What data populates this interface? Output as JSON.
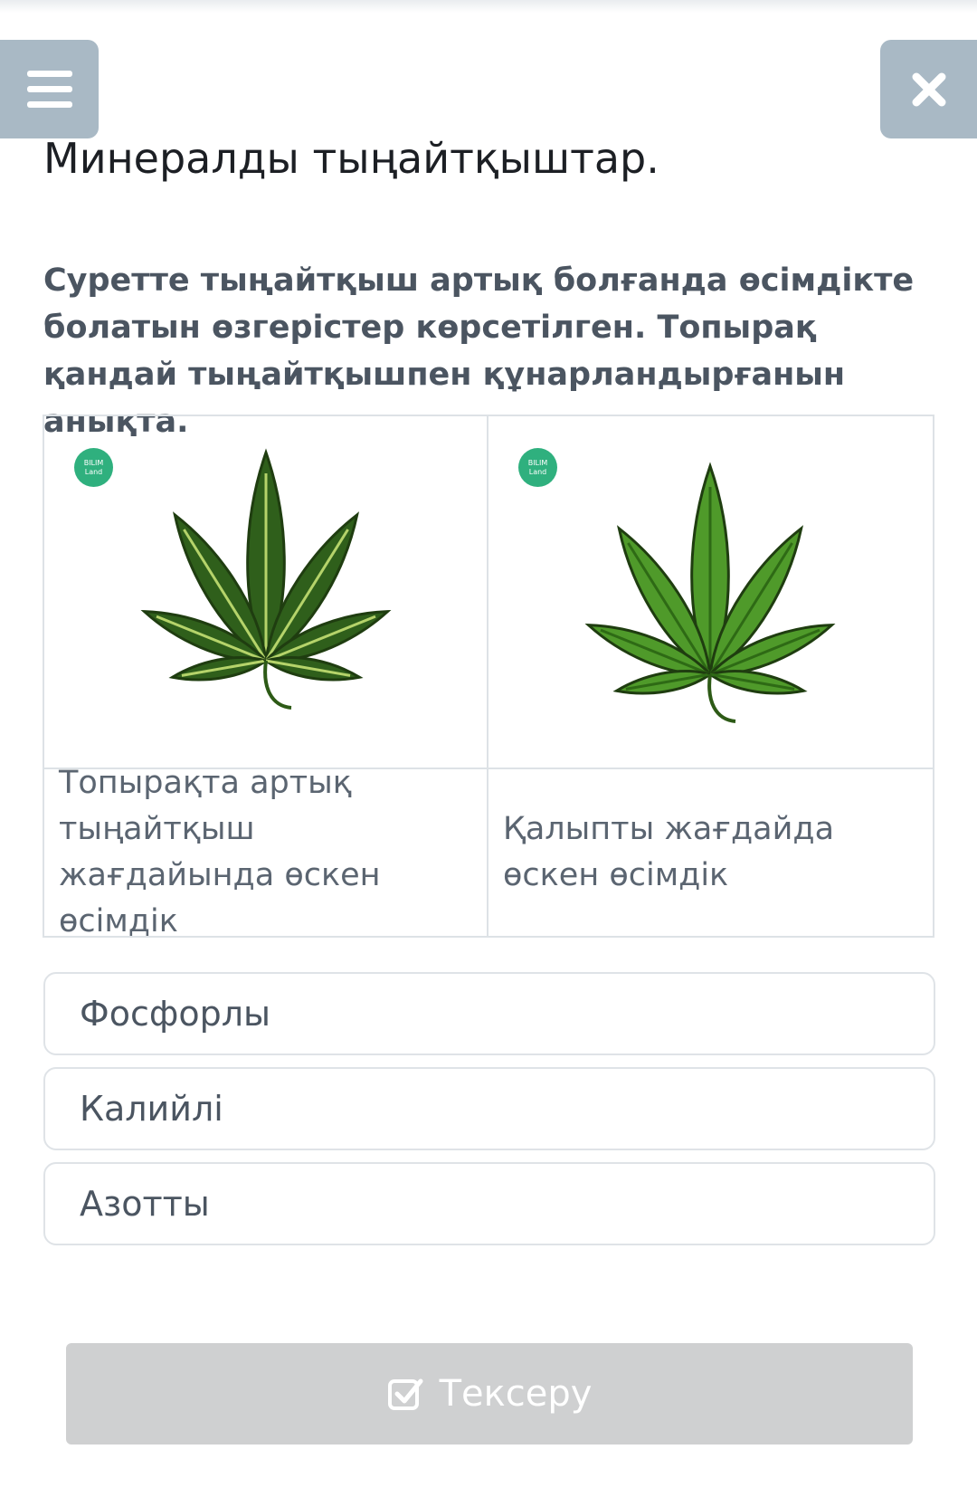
{
  "header": {
    "menu_icon": "hamburger-menu-icon",
    "close_icon": "close-icon",
    "title": "Минералды тыңайтқыштар."
  },
  "question": {
    "text": "Суретте тыңайтқыш артық болғанда өсімдікте болатын өзгерістер көрсетілген. Топырақ қандай тыңайтқышпен құнарландырғанын анықта."
  },
  "figures": [
    {
      "badge_top": "BILIM",
      "badge_bottom": "Land",
      "leaf_color": "#2f5f1b",
      "caption": "Топырақта артық тыңайтқыш жағдайында өскен өсімдік"
    },
    {
      "badge_top": "BILIM",
      "badge_bottom": "Land",
      "leaf_color": "#4f9a2a",
      "caption": "Қалыпты жағдайда өскен өсімдік"
    }
  ],
  "options": [
    {
      "label": "Фосфорлы"
    },
    {
      "label": "Калийлі"
    },
    {
      "label": "Азотты"
    }
  ],
  "submit": {
    "icon": "check-square-icon",
    "label": "Тексеру"
  },
  "colors": {
    "header_buttons": "#a9b9c5",
    "submit_disabled": "#cfd0d1",
    "badge": "#2fb07e"
  }
}
